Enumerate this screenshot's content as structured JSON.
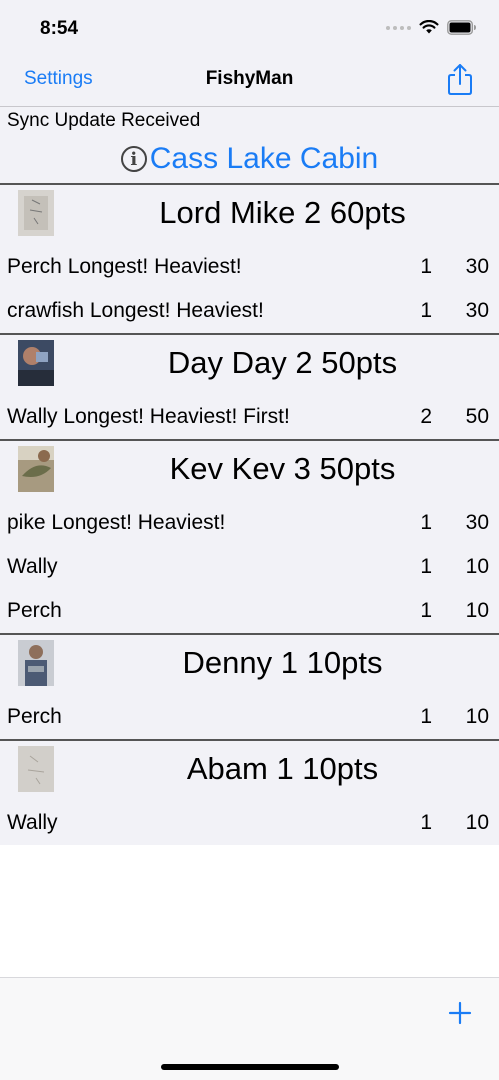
{
  "status_bar": {
    "time": "8:54"
  },
  "nav": {
    "left_label": "Settings",
    "title": "FishyMan",
    "right_icon": "share-icon"
  },
  "sync_text": "Sync Update Received",
  "location": {
    "icon": "info-icon",
    "info_glyph": "i",
    "name": "Cass Lake Cabin"
  },
  "players": [
    {
      "name": "Lord Mike 2 60pts",
      "catches": [
        {
          "name": "Perch Longest! Heaviest!",
          "count": "1",
          "pts": "30"
        },
        {
          "name": "crawfish Longest! Heaviest!",
          "count": "1",
          "pts": "30"
        }
      ]
    },
    {
      "name": "Day Day 2 50pts",
      "catches": [
        {
          "name": "Wally Longest! Heaviest! First!",
          "count": "2",
          "pts": "50"
        }
      ]
    },
    {
      "name": "Kev Kev 3 50pts",
      "catches": [
        {
          "name": "pike Longest! Heaviest!",
          "count": "1",
          "pts": "30"
        },
        {
          "name": "Wally",
          "count": "1",
          "pts": "10"
        },
        {
          "name": "Perch",
          "count": "1",
          "pts": "10"
        }
      ]
    },
    {
      "name": "Denny 1 10pts",
      "catches": [
        {
          "name": "Perch",
          "count": "1",
          "pts": "10"
        }
      ]
    },
    {
      "name": "Abam 1 10pts",
      "catches": [
        {
          "name": "Wally",
          "count": "1",
          "pts": "10"
        }
      ]
    }
  ],
  "toolbar": {
    "add_icon": "plus-icon"
  },
  "colors": {
    "accent": "#1a7cf5",
    "background": "#f2f2f7",
    "divider": "#555555"
  }
}
